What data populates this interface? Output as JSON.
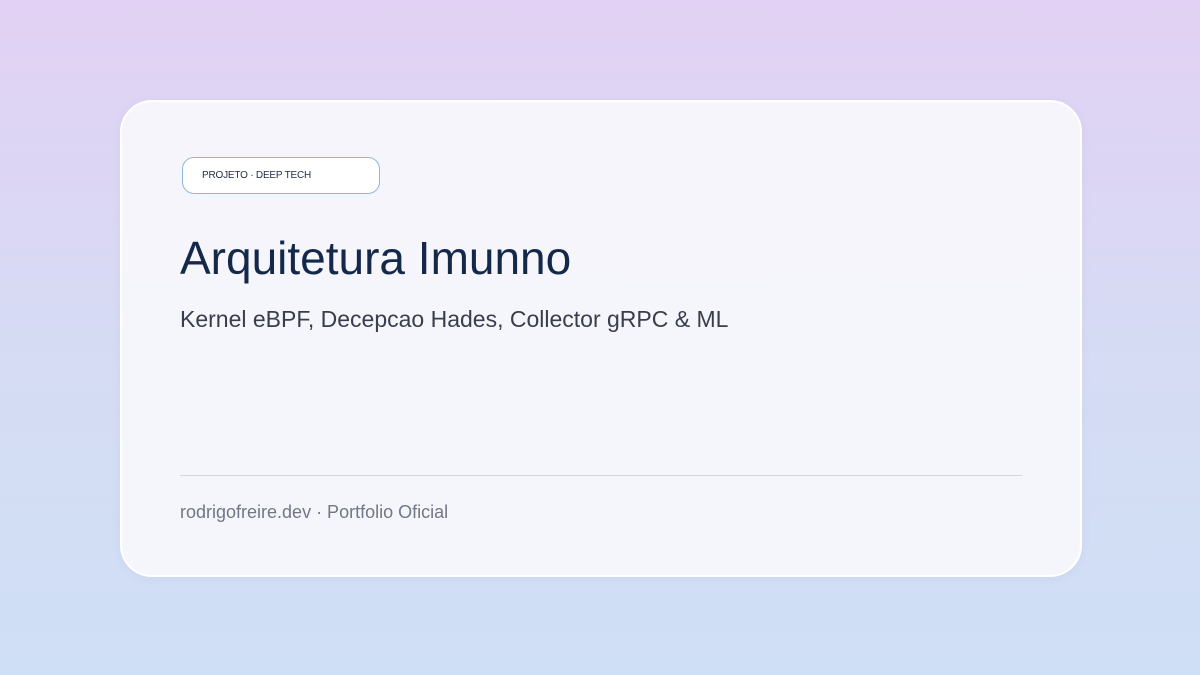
{
  "card": {
    "badge": "PROJETO · DEEP TECH",
    "title": "Arquitetura Imunno",
    "subtitle": "Kernel eBPF, Decepcao Hades, Collector gRPC & ML",
    "footer": "rodrigofreire.dev · Portfolio Oficial"
  },
  "colors": {
    "background_top": "#e2d1f4",
    "background_bottom": "#cfdff5",
    "title": "#14294a",
    "badge_border": "#8fb7de"
  }
}
